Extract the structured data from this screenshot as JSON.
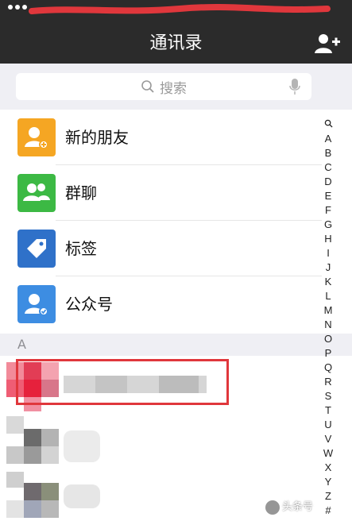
{
  "navbar": {
    "title": "通讯录"
  },
  "search": {
    "placeholder": "搜索"
  },
  "function_rows": [
    {
      "label": "新的朋友",
      "color": "#f5a623",
      "icon": "new-friend-icon"
    },
    {
      "label": "群聊",
      "color": "#3cb944",
      "icon": "group-chat-icon"
    },
    {
      "label": "标签",
      "color": "#2f71c9",
      "icon": "tag-icon"
    },
    {
      "label": "公众号",
      "color": "#3d8de2",
      "icon": "official-account-icon"
    }
  ],
  "section": {
    "label": "A"
  },
  "index_letters": [
    "Q",
    "A",
    "B",
    "C",
    "D",
    "E",
    "F",
    "G",
    "H",
    "I",
    "J",
    "K",
    "L",
    "M",
    "N",
    "O",
    "P",
    "Q",
    "R",
    "S",
    "T",
    "U",
    "V",
    "W",
    "X",
    "Y",
    "Z",
    "#"
  ],
  "watermark": {
    "text": "头条号"
  },
  "colors": {
    "nav": "#2b2b2b",
    "highlight": "#e0373c",
    "group_bg": "#efeff4"
  }
}
